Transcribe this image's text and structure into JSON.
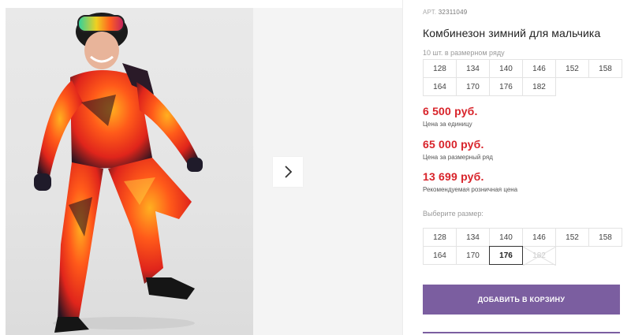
{
  "product": {
    "art_label": "АРТ.",
    "art_number": "32311049",
    "title": "Комбинезон зимний для мальчика",
    "row_label": "10 шт. в размерном ряду",
    "row_sizes": [
      "128",
      "134",
      "140",
      "146",
      "152",
      "158",
      "164",
      "170",
      "176",
      "182"
    ]
  },
  "prices": [
    {
      "value": "6 500 руб.",
      "note": "Цена за единицу"
    },
    {
      "value": "65 000 руб.",
      "note": "Цена за размерный ряд"
    },
    {
      "value": "13 699 руб.",
      "note": "Рекомендуемая розничная цена"
    }
  ],
  "size_picker": {
    "label": "Выберите размер:",
    "sizes": [
      {
        "label": "128",
        "state": "available"
      },
      {
        "label": "134",
        "state": "available"
      },
      {
        "label": "140",
        "state": "available"
      },
      {
        "label": "146",
        "state": "available"
      },
      {
        "label": "152",
        "state": "available"
      },
      {
        "label": "158",
        "state": "available"
      },
      {
        "label": "164",
        "state": "available"
      },
      {
        "label": "170",
        "state": "available"
      },
      {
        "label": "176",
        "state": "selected"
      },
      {
        "label": "182",
        "state": "disabled"
      }
    ]
  },
  "cart_button": "ДОБАВИТЬ В КОРЗИНУ",
  "gallery": {
    "next_icon": "chevron-right-icon"
  },
  "colors": {
    "accent": "#7b5ea0",
    "price": "#d8232a"
  }
}
